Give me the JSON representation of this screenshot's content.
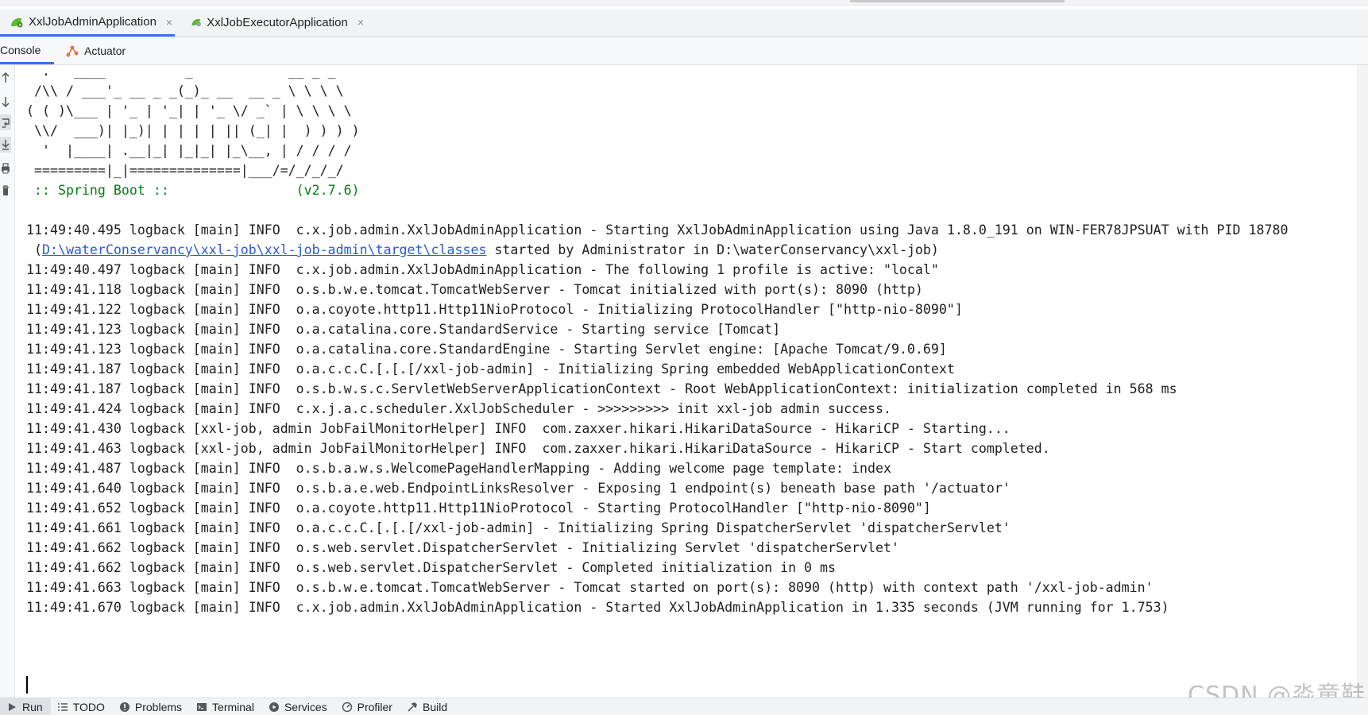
{
  "run_tabs": [
    {
      "label": "XxlJobAdminApplication",
      "active": true
    },
    {
      "label": "XxlJobExecutorApplication",
      "active": false
    }
  ],
  "close_glyph": "×",
  "sub_tabs": [
    {
      "label": "Console",
      "active": true
    },
    {
      "label": "Actuator",
      "active": false
    }
  ],
  "banner": [
    "  .   ____          _            __ _ _",
    " /\\\\ / ___'_ __ _ _(_)_ __  __ _ \\ \\ \\ \\",
    "( ( )\\___ | '_ | '_| | '_ \\/ _` | \\ \\ \\ \\",
    " \\\\/  ___)| |_)| | | | | || (_| |  ) ) ) )",
    "  '  |____| .__|_| |_|_| |_\\__, | / / / /",
    " =========|_|==============|___/=/_/_/_/"
  ],
  "spring_boot_line": " :: Spring Boot ::                (v2.7.6)",
  "log_first": "11:49:40.495 logback [main] INFO  c.x.job.admin.XxlJobAdminApplication - Starting XxlJobAdminApplication using Java 1.8.0_191 on WIN-FER78JPSUAT with PID 18780",
  "log_cont_prefix": " (",
  "log_cont_link": "D:\\waterConservancy\\xxl-job\\xxl-job-admin\\target\\classes",
  "log_cont_suffix": " started by Administrator in D:\\waterConservancy\\xxl-job)",
  "log_rest": [
    "11:49:40.497 logback [main] INFO  c.x.job.admin.XxlJobAdminApplication - The following 1 profile is active: \"local\"",
    "11:49:41.118 logback [main] INFO  o.s.b.w.e.tomcat.TomcatWebServer - Tomcat initialized with port(s): 8090 (http)",
    "11:49:41.122 logback [main] INFO  o.a.coyote.http11.Http11NioProtocol - Initializing ProtocolHandler [\"http-nio-8090\"]",
    "11:49:41.123 logback [main] INFO  o.a.catalina.core.StandardService - Starting service [Tomcat]",
    "11:49:41.123 logback [main] INFO  o.a.catalina.core.StandardEngine - Starting Servlet engine: [Apache Tomcat/9.0.69]",
    "11:49:41.187 logback [main] INFO  o.a.c.c.C.[.[.[/xxl-job-admin] - Initializing Spring embedded WebApplicationContext",
    "11:49:41.187 logback [main] INFO  o.s.b.w.s.c.ServletWebServerApplicationContext - Root WebApplicationContext: initialization completed in 568 ms",
    "11:49:41.424 logback [main] INFO  c.x.j.a.c.scheduler.XxlJobScheduler - >>>>>>>>> init xxl-job admin success.",
    "11:49:41.430 logback [xxl-job, admin JobFailMonitorHelper] INFO  com.zaxxer.hikari.HikariDataSource - HikariCP - Starting...",
    "11:49:41.463 logback [xxl-job, admin JobFailMonitorHelper] INFO  com.zaxxer.hikari.HikariDataSource - HikariCP - Start completed.",
    "11:49:41.487 logback [main] INFO  o.s.b.a.w.s.WelcomePageHandlerMapping - Adding welcome page template: index",
    "11:49:41.640 logback [main] INFO  o.s.b.a.e.web.EndpointLinksResolver - Exposing 1 endpoint(s) beneath base path '/actuator'",
    "11:49:41.652 logback [main] INFO  o.a.coyote.http11.Http11NioProtocol - Starting ProtocolHandler [\"http-nio-8090\"]",
    "11:49:41.661 logback [main] INFO  o.a.c.c.C.[.[.[/xxl-job-admin] - Initializing Spring DispatcherServlet 'dispatcherServlet'",
    "11:49:41.662 logback [main] INFO  o.s.web.servlet.DispatcherServlet - Initializing Servlet 'dispatcherServlet'",
    "11:49:41.662 logback [main] INFO  o.s.web.servlet.DispatcherServlet - Completed initialization in 0 ms",
    "11:49:41.663 logback [main] INFO  o.s.b.w.e.tomcat.TomcatWebServer - Tomcat started on port(s): 8090 (http) with context path '/xxl-job-admin'",
    "11:49:41.670 logback [main] INFO  c.x.job.admin.XxlJobAdminApplication - Started XxlJobAdminApplication in 1.335 seconds (JVM running for 1.753)"
  ],
  "bottom_tools": [
    {
      "label": "Run",
      "icon": "run-icon",
      "active": true
    },
    {
      "label": "TODO",
      "icon": "todo-icon",
      "active": false
    },
    {
      "label": "Problems",
      "icon": "problems-icon",
      "active": false
    },
    {
      "label": "Terminal",
      "icon": "terminal-icon",
      "active": false
    },
    {
      "label": "Services",
      "icon": "services-icon",
      "active": false
    },
    {
      "label": "Profiler",
      "icon": "profiler-icon",
      "active": false
    },
    {
      "label": "Build",
      "icon": "build-icon",
      "active": false
    }
  ],
  "watermark": "CSDN @淼童鞋",
  "colors": {
    "accent": "#3574f0",
    "spring_green": "#067d17",
    "link": "#2a5ec8",
    "spring_icon": "#5fb832"
  }
}
